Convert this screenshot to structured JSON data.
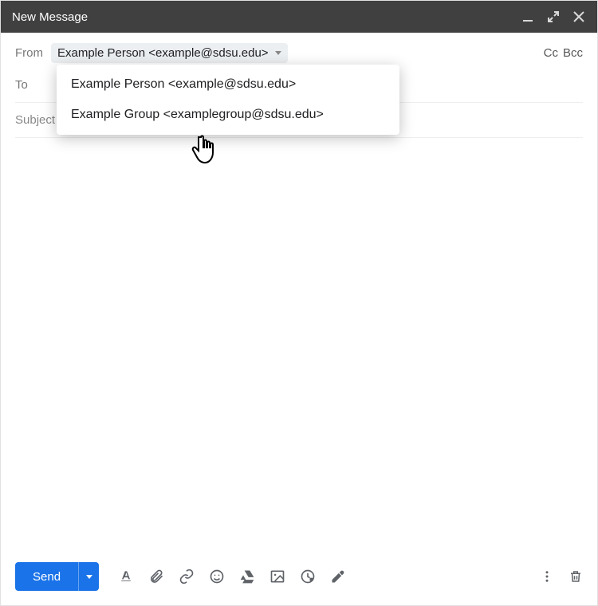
{
  "header": {
    "title": "New Message"
  },
  "from": {
    "label": "From",
    "selected": "Example Person <example@sdsu.edu>",
    "options": [
      "Example Person <example@sdsu.edu>",
      "Example Group <examplegroup@sdsu.edu>"
    ]
  },
  "to": {
    "label": "To",
    "cc_label": "Cc",
    "bcc_label": "Bcc"
  },
  "subject": {
    "placeholder": "Subject"
  },
  "toolbar": {
    "send_label": "Send"
  }
}
